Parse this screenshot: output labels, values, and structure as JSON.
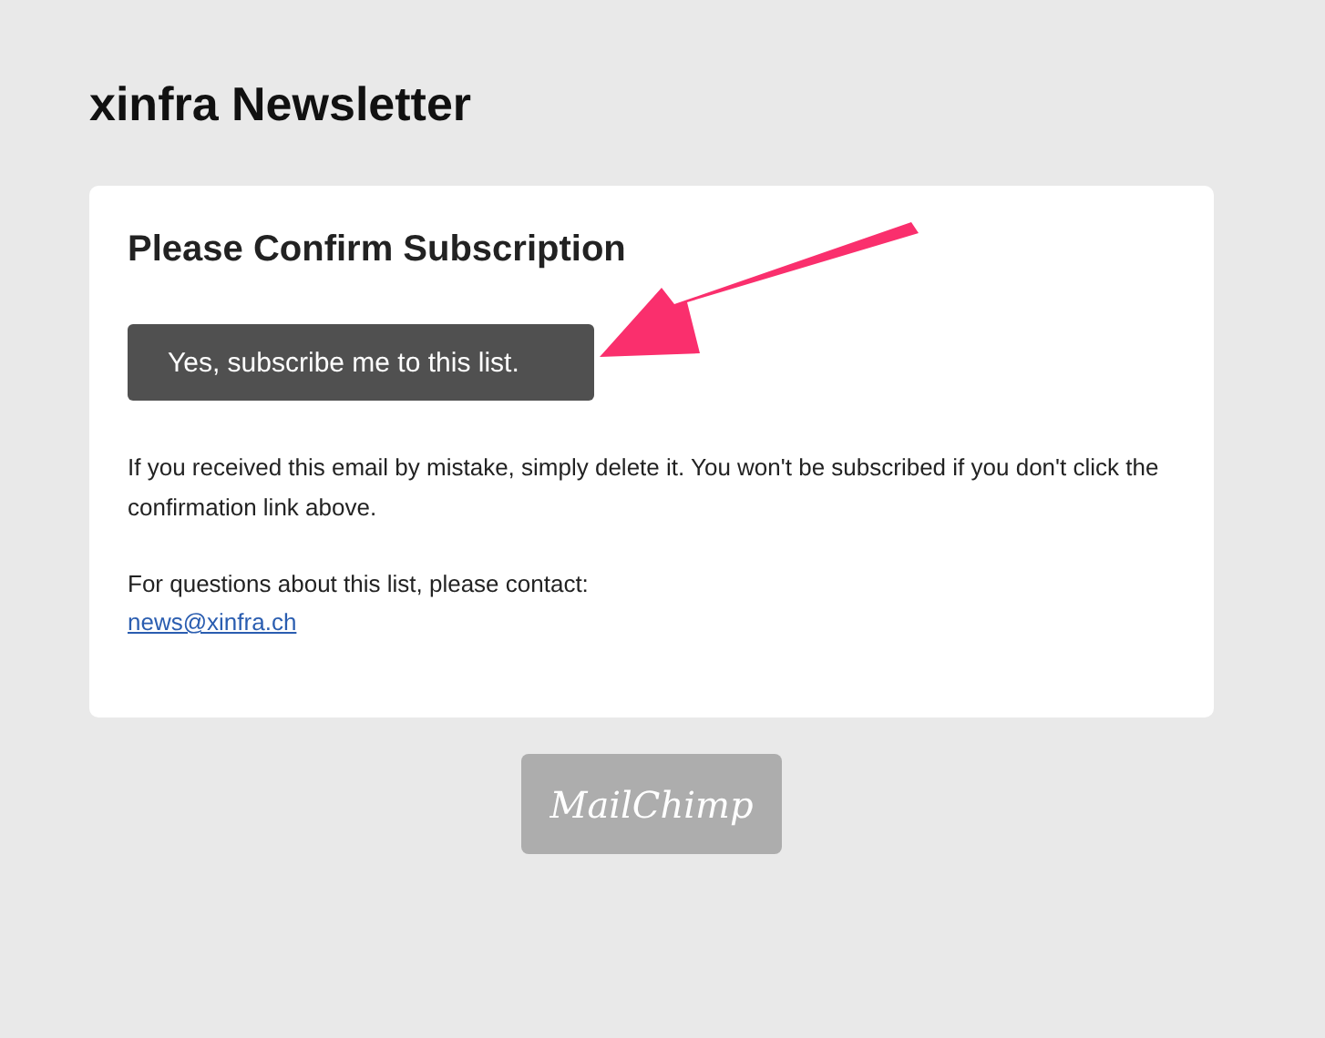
{
  "page_title": "xinfra Newsletter",
  "card": {
    "title": "Please Confirm Subscription",
    "button": "Yes, subscribe me to this list.",
    "notice": "If you received this email by mistake, simply delete it. You won't be subscribed if you don't click the confirmation link above.",
    "contact_text": "For questions about this list, please contact:",
    "contact_email": "news@xinfra.ch"
  },
  "footer_logo": "MailChimp"
}
